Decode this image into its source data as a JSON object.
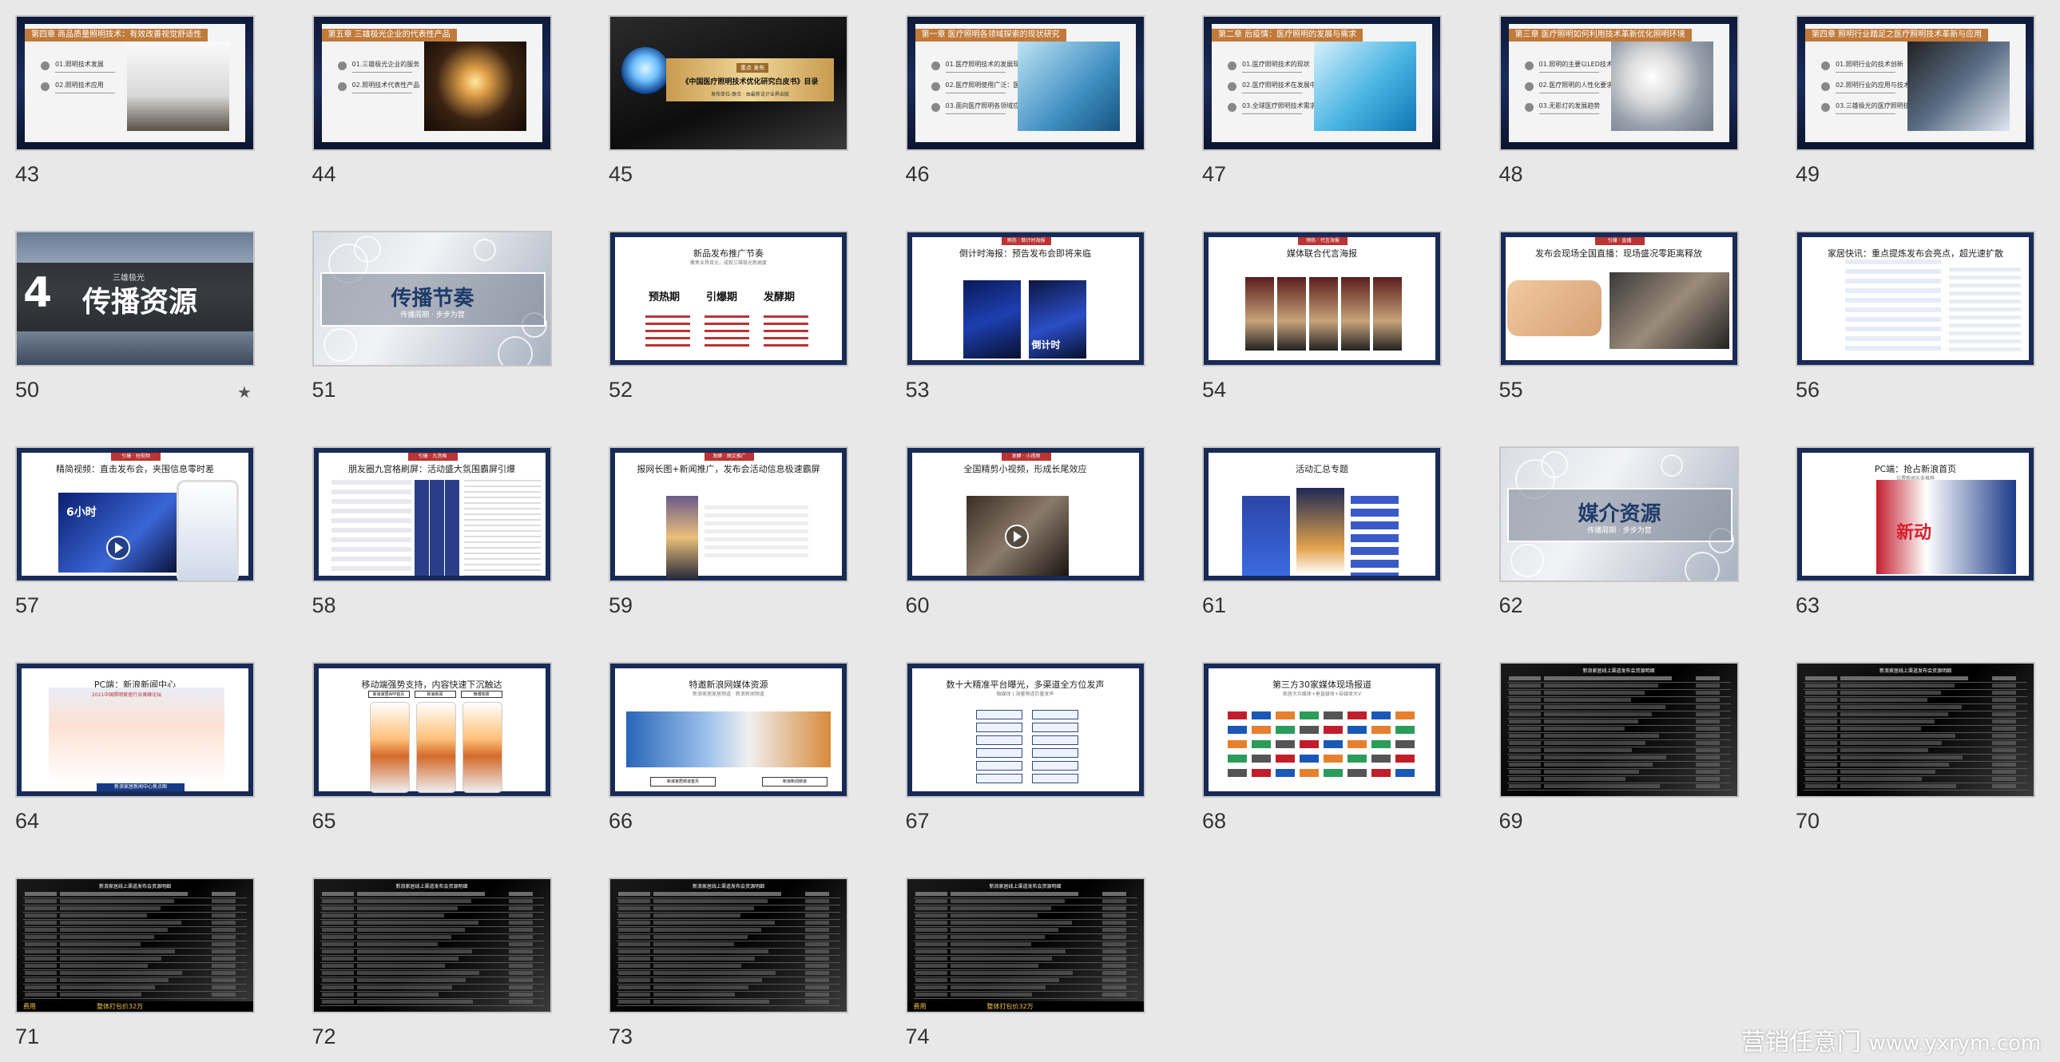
{
  "slides": [
    {
      "n": "43",
      "type": "chapter",
      "chapter": "第四章 商品质量照明技术：有效改善视觉舒适性",
      "items": [
        "01.照明技术发展",
        "02.照明技术应用"
      ],
      "photo": "pendant-lamps"
    },
    {
      "n": "44",
      "type": "chapter",
      "chapter": "第五章 三雄极光企业的代表性产品",
      "items": [
        "01.三雄极光企业的服务",
        "02.照明技术代表性产品"
      ],
      "photo": "bulb"
    },
    {
      "n": "45",
      "type": "banner",
      "tag": "重点 发布",
      "title": "《中国医疗照明技术优化研究白皮书》目录",
      "sub": "发布单位-联合 · 由最新设计业界出版"
    },
    {
      "n": "46",
      "type": "chapter",
      "chapter": "第一章 医疗照明各领域探索的现状研究",
      "items": [
        "01.医疗照明技术的发展现状",
        "02.医疗照明使用广泛：医疗—医院医用照明",
        "03.面向医疗照明各领域应用的发展"
      ],
      "photo": "operating-room"
    },
    {
      "n": "47",
      "type": "chapter",
      "chapter": "第二章 后疫情：医疗照明的发展与需求",
      "items": [
        "01.医疗照明技术的现状",
        "02.医疗照明技术在发展中发展",
        "03.全球医疗照明技术需求"
      ],
      "photo": "lab"
    },
    {
      "n": "48",
      "type": "chapter",
      "chapter": "第三章 医疗照明如何利用技术革新优化照明环境",
      "items": [
        "01.照明的主要以LED技术",
        "02.医疗照明的人性化要求",
        "03.无影灯的发展趋势"
      ],
      "photo": "surgical-lamp"
    },
    {
      "n": "49",
      "type": "chapter",
      "chapter": "第四章 照明行业踏足之医疗照明技术革新与应用",
      "items": [
        "01.照明行业的技术创新",
        "02.照明行业的应用与技术",
        "03.三雄极光的医疗照明技术"
      ],
      "photo": "mri"
    },
    {
      "n": "50",
      "type": "section",
      "num": "4",
      "title": "传播资源",
      "sub": "三雄极光",
      "starred": true
    },
    {
      "n": "51",
      "type": "boxed",
      "title": "传播节奏",
      "sub": "传播周期 · 步步为营"
    },
    {
      "n": "52",
      "type": "phases",
      "head": "新品发布推广节奏",
      "subhead": "聚焦业界目光，成就三雄极光新高度",
      "phases": [
        "预热期",
        "引爆期",
        "发酵期"
      ]
    },
    {
      "n": "53",
      "type": "poster",
      "tag": "预热 · 倒计时海报",
      "head": "倒计时海报：预告发布会即将来临",
      "overlay": "倒计时"
    },
    {
      "n": "54",
      "type": "gallery",
      "tag": "预热 · 代言海报",
      "head": "媒体联合代言海报"
    },
    {
      "n": "55",
      "type": "live",
      "tag": "引爆 · 直播",
      "head": "发布会现场全国直播：现场盛况零距离释放"
    },
    {
      "n": "56",
      "type": "news",
      "head": "家居快讯：重点提炼发布会亮点，超光速扩散"
    },
    {
      "n": "57",
      "type": "video",
      "tag": "引爆 · 短视频",
      "head": "精简视频：直击发布会，夹围信息零时差",
      "overlay": "6小时"
    },
    {
      "n": "58",
      "type": "articles",
      "tag": "引爆 · 九宫格",
      "head": "朋友圈九宫格刷屏：活动盛大氛围霸屏引爆"
    },
    {
      "n": "59",
      "type": "longimg",
      "tag": "发酵 · 图文推广",
      "head": "报网长图+新闻推广，发布会活动信息极速霸屏"
    },
    {
      "n": "60",
      "type": "video2",
      "tag": "发酵 · 小视频",
      "head": "全国精剪小视频，形成长尾效应"
    },
    {
      "n": "61",
      "type": "summary",
      "head": "活动汇总专题"
    },
    {
      "n": "62",
      "type": "boxed",
      "title": "媒介资源",
      "sub": "传播周期 · 步步为营"
    },
    {
      "n": "63",
      "type": "pc",
      "head": "PC端：抢占新浪首页",
      "subhead": "位置新闻头条推荐",
      "overlay": "新动"
    },
    {
      "n": "64",
      "type": "pc2",
      "head": "PC端：新浪新闻中心",
      "banner": "2021中国照明家居行业高峰论坛",
      "foot": "新浪家居新闻中心焦点图"
    },
    {
      "n": "65",
      "type": "mobile",
      "head": "移动端强势支持，内容快速下沉触达",
      "labels": [
        "新浪家居APP首页",
        "新浪新闻",
        "微博热搜"
      ]
    },
    {
      "n": "66",
      "type": "media",
      "head": "特邀新浪网媒体资源",
      "subhead": "新浪家居家居频道 · 新浪新闻频道",
      "labels": [
        "新浪家居频道首页",
        "新浪新闻频道"
      ]
    },
    {
      "n": "67",
      "type": "matrix",
      "head": "数十大精准平台曝光，多渠道全方位发声",
      "subhead": "融媒体 | 海量频道巨量发声"
    },
    {
      "n": "68",
      "type": "logos",
      "head": "第三方30家媒体现场报道",
      "subhead": "家居大众媒体+垂直媒体+自媒体大V"
    },
    {
      "n": "69",
      "type": "table",
      "title": "新浪家居线上渠道发布会资源明细"
    },
    {
      "n": "70",
      "type": "table",
      "title": "新浪家居线上渠道发布会资源明细"
    },
    {
      "n": "71",
      "type": "table",
      "title": "新浪家居线上渠道发布会资源明细",
      "foot_left": "费用",
      "foot_center": "整体打包价32万"
    },
    {
      "n": "72",
      "type": "table",
      "title": "新浪家居线上渠道发布会资源明细"
    },
    {
      "n": "73",
      "type": "table",
      "title": "新浪家居线上渠道发布会资源明细"
    },
    {
      "n": "74",
      "type": "table",
      "title": "新浪家居线上渠道发布会资源明细",
      "foot_left": "费用",
      "foot_center": "整体打包价32万"
    }
  ],
  "watermark": {
    "brand": "营销任意门",
    "url": "www.yxrym.com"
  }
}
